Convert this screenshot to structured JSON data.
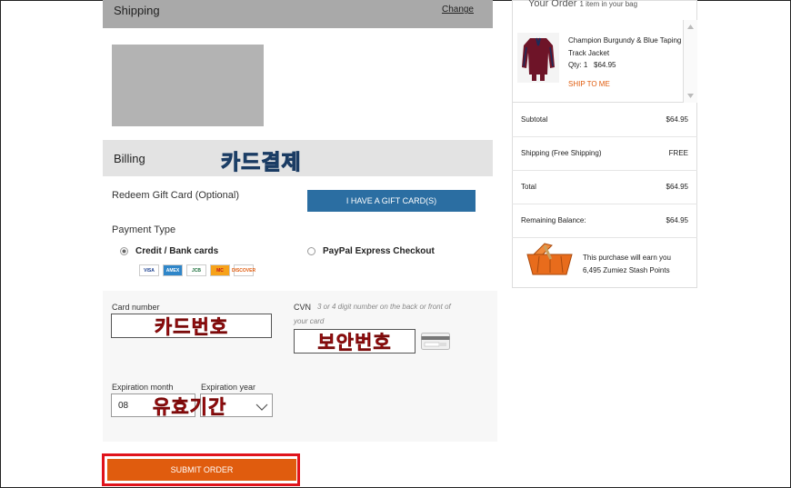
{
  "shipping": {
    "title": "Shipping",
    "change_label": "Change"
  },
  "billing": {
    "title": "Billing",
    "annotation": "카드결제"
  },
  "gift": {
    "label": "Redeem Gift Card (Optional)",
    "button": "I HAVE A GIFT CARD(S)"
  },
  "payment": {
    "type_label": "Payment Type",
    "options": [
      {
        "label": "Credit / Bank cards",
        "selected": true
      },
      {
        "label": "PayPal Express Checkout",
        "selected": false
      }
    ],
    "card_logos": [
      "VISA",
      "AMEX",
      "JCB",
      "MC",
      "DISCOVER"
    ]
  },
  "card_form": {
    "card_number_label": "Card number",
    "card_number_annotation": "카드번호",
    "cvn_label": "CVN",
    "cvn_hint": "3 or 4 digit number on the back or front of your card",
    "cvn_annotation": "보안번호",
    "exp_month_label": "Expiration month",
    "exp_year_label": "Expiration year",
    "exp_month_value": "08",
    "expiry_annotation": "유효기간"
  },
  "submit": {
    "label": "SUBMIT ORDER"
  },
  "order": {
    "title": "Your Order",
    "count_text": "1 item in your bag",
    "item": {
      "name": "Champion Burgundy & Blue Taping Track Jacket",
      "qty_label": "Qty: 1",
      "price": "$64.95",
      "ship_label": "SHIP TO ME"
    },
    "summary": [
      {
        "label": "Subtotal",
        "value": "$64.95"
      },
      {
        "label": "Shipping (Free Shipping)",
        "value": "FREE"
      },
      {
        "label": "Total",
        "value": "$64.95"
      },
      {
        "label": "Remaining Balance:",
        "value": "$64.95"
      }
    ],
    "stash_line1": "This purchase will earn you",
    "stash_line2": "6,495 Zumiez Stash Points"
  },
  "colors": {
    "accent_orange": "#e05c0e",
    "button_blue": "#2b6ea2",
    "highlight_red": "#e0131b",
    "annotation_cyan": "#29c3dc"
  }
}
